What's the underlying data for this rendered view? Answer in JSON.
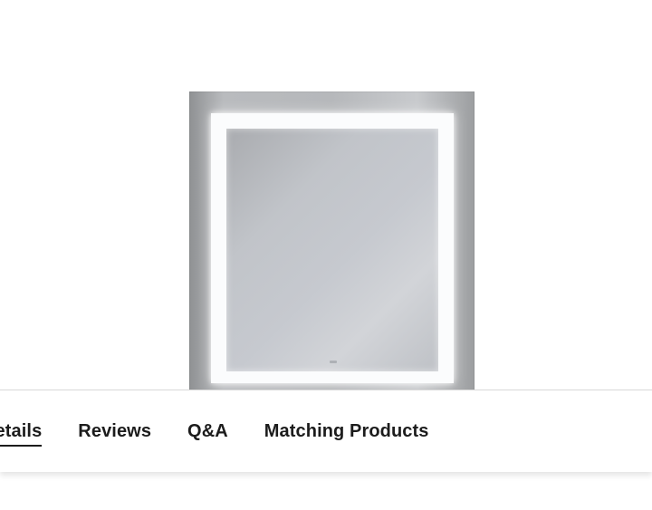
{
  "product": {
    "image_alt": "Lighted bathroom mirror"
  },
  "tabs": [
    {
      "label": "Details",
      "active": true
    },
    {
      "label": "Reviews",
      "active": false
    },
    {
      "label": "Q&A",
      "active": false
    },
    {
      "label": "Matching Products",
      "active": false
    }
  ]
}
